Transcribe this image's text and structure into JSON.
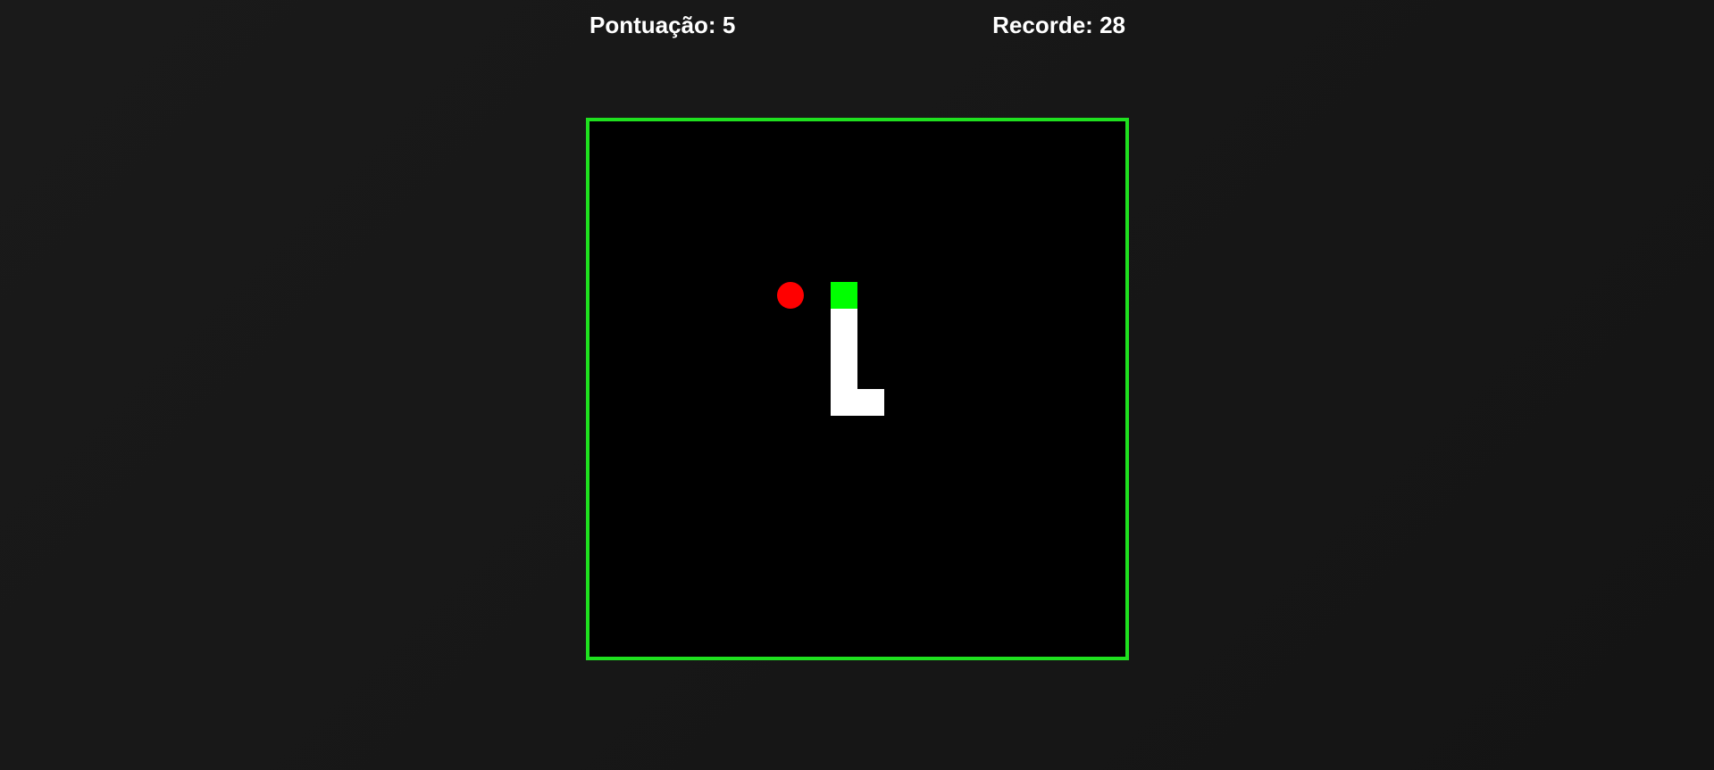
{
  "scoreboard": {
    "score_label": "Pontuação:",
    "score_value": "5",
    "record_label": "Recorde:",
    "record_value": "28"
  },
  "game": {
    "grid_cols": 20,
    "grid_rows": 20,
    "food": {
      "col": 7,
      "row": 6
    },
    "snake": [
      {
        "col": 9,
        "row": 6
      },
      {
        "col": 9,
        "row": 7
      },
      {
        "col": 9,
        "row": 8
      },
      {
        "col": 9,
        "row": 9
      },
      {
        "col": 9,
        "row": 10
      },
      {
        "col": 10,
        "row": 10
      }
    ]
  },
  "colors": {
    "background": "#161616",
    "board_border": "#1fe01f",
    "board_fill": "#000000",
    "snake_head": "#00ff00",
    "snake_body": "#ffffff",
    "food": "#ff0000",
    "text": "#ffffff"
  }
}
